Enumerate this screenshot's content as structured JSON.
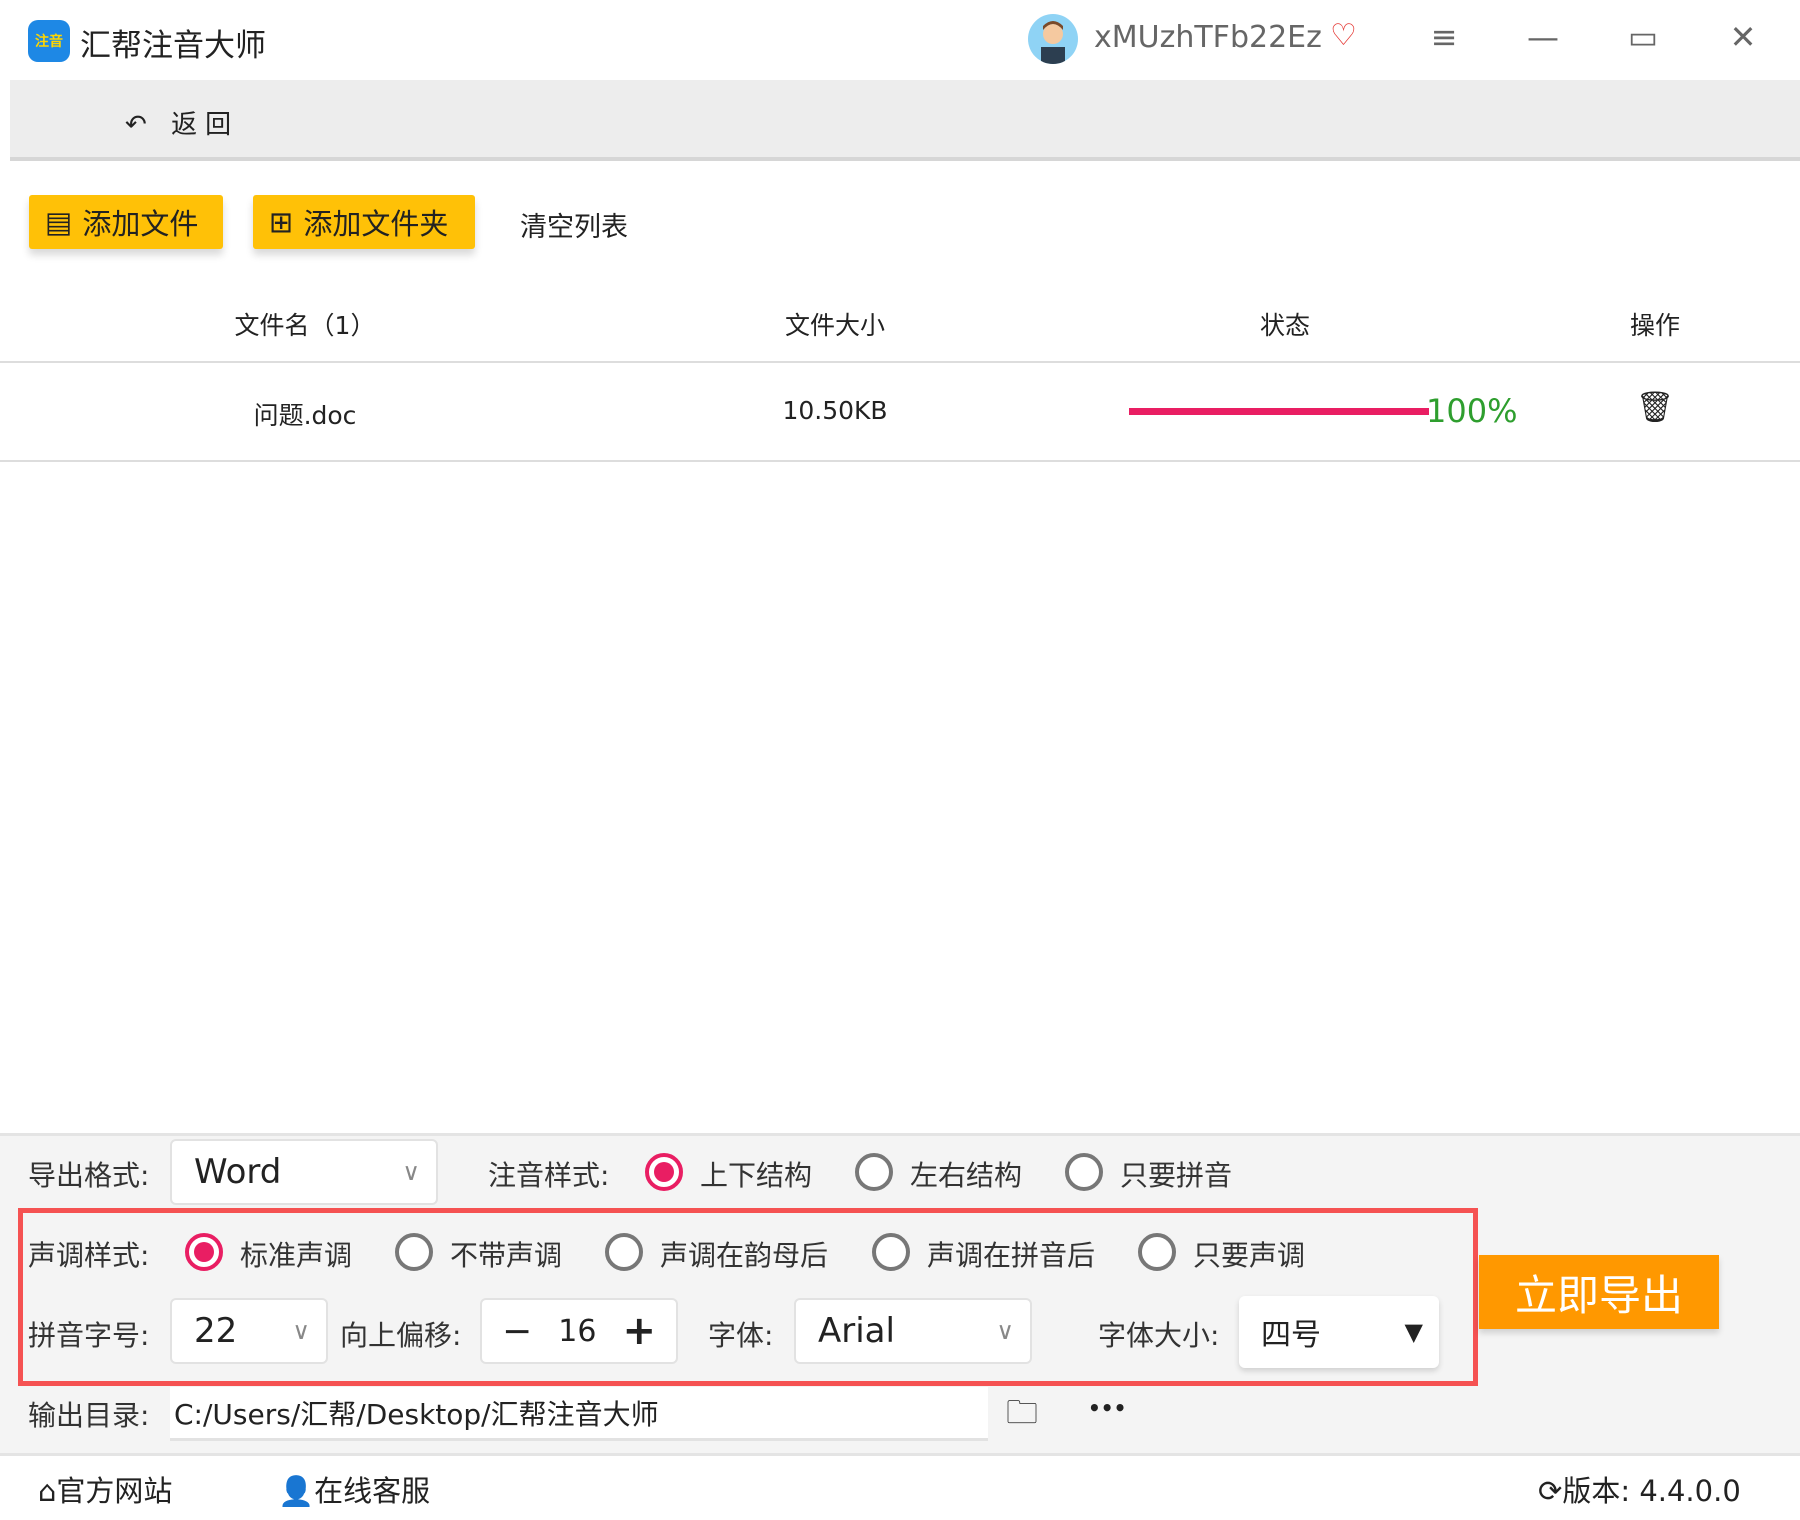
{
  "app": {
    "title": "汇帮注音大师",
    "logo_text": "注音",
    "username": "xMUzhTFb22Ez"
  },
  "nav": {
    "back_label": "返回"
  },
  "toolbar": {
    "add_file": "添加文件",
    "add_folder": "添加文件夹",
    "clear_list": "清空列表"
  },
  "table": {
    "headers": [
      "文件名（1）",
      "文件大小",
      "状态",
      "操作"
    ],
    "rows": [
      {
        "name": "问题.doc",
        "size": "10.50KB",
        "progress": 100,
        "progress_label": "100%"
      }
    ]
  },
  "settings": {
    "export_format_label": "导出格式:",
    "export_format": "Word",
    "annotation_style_label": "注音样式:",
    "annotation_styles": [
      "上下结构",
      "左右结构",
      "只要拼音"
    ],
    "annotation_selected": 0,
    "tone_style_label": "声调样式:",
    "tone_styles": [
      "标准声调",
      "不带声调",
      "声调在韵母后",
      "声调在拼音后",
      "只要声调"
    ],
    "tone_selected": 0,
    "pinyin_size_label": "拼音字号:",
    "pinyin_size": "22",
    "offset_label": "向上偏移:",
    "offset": "16",
    "minus": "−",
    "plus": "+",
    "font_label": "字体:",
    "font": "Arial",
    "font_size_label": "字体大小:",
    "font_size": "四号",
    "output_dir_label": "输出目录:",
    "output_dir": "C:/Users/汇帮/Desktop/汇帮注音大师",
    "more": "•••",
    "export_button": "立即导出"
  },
  "footer": {
    "website": "官方网站",
    "support": "在线客服",
    "version_label": "版本:",
    "version": "4.4.0.0"
  },
  "colors": {
    "accent": "#e91e63",
    "yellow": "#ffc107",
    "orange": "#ff9800",
    "highlight": "#f55252",
    "success": "#2e9e2e"
  }
}
